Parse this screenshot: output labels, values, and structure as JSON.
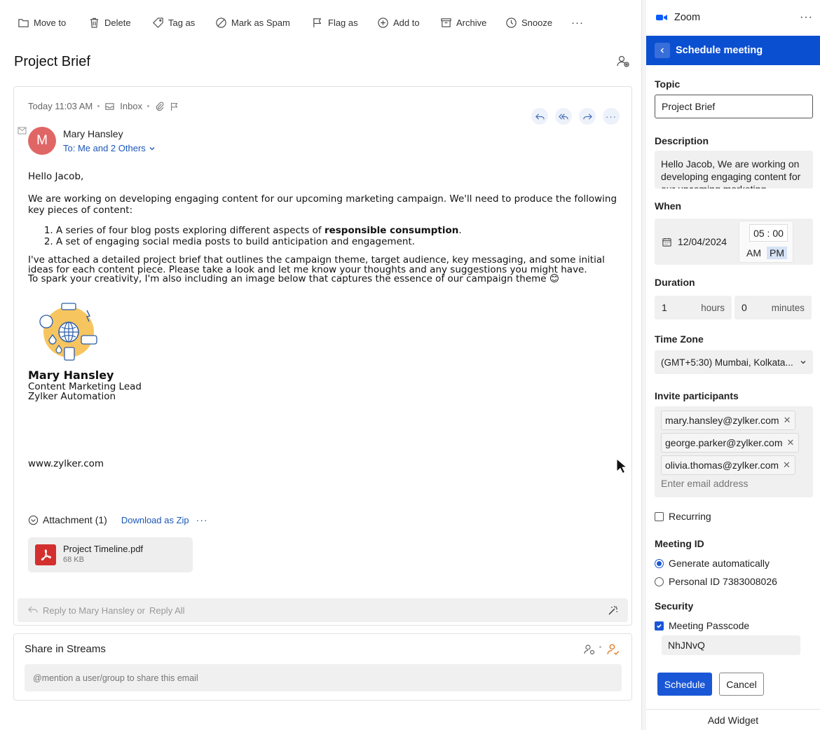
{
  "toolbar": {
    "items": [
      {
        "label": "Move to",
        "icon": "folder-icon"
      },
      {
        "label": "Delete",
        "icon": "trash-icon"
      },
      {
        "label": "Tag as",
        "icon": "tag-icon"
      },
      {
        "label": "Mark as Spam",
        "icon": "spam-icon"
      },
      {
        "label": "Flag as",
        "icon": "flag-icon"
      },
      {
        "label": "Add to",
        "icon": "plus-circle-icon"
      },
      {
        "label": "Archive",
        "icon": "archive-icon"
      },
      {
        "label": "Snooze",
        "icon": "clock-icon"
      }
    ],
    "more": "···"
  },
  "email": {
    "subject": "Project Brief",
    "time": "Today 11:03 AM",
    "folder": "Inbox",
    "sender_initial": "M",
    "sender_name": "Mary Hansley",
    "to_line": "To: Me and 2 Others",
    "greeting": "Hello Jacob,",
    "para1": "We are working on developing engaging content for our upcoming marketing campaign. We'll need to produce the following key pieces of content:",
    "list1_pre": "A series of four blog posts exploring different aspects of ",
    "list1_bold": "responsible consumption",
    "list1_post": ".",
    "list2": "A set of engaging social media posts to build anticipation and engagement.",
    "para2_line1": "I've attached a detailed project brief that outlines the campaign theme, target audience, key messaging, and some initial ideas for each content piece. Please take a look and let me know your thoughts and any suggestions you might have.",
    "para2_line2": "To spark your creativity, I'm also including an image below that captures the essence of our campaign theme 😊",
    "sig_name": "Mary Hansley",
    "sig_role": "Content Marketing Lead",
    "sig_company": "Zylker Automation",
    "sig_web": "www.zylker.com"
  },
  "attachments": {
    "header": "Attachment (1)",
    "download": "Download as Zip",
    "more": "···",
    "file_name": "Project Timeline.pdf",
    "file_size": "68 KB"
  },
  "reply": {
    "reply_text": "Reply to Mary Hansley or",
    "reply_all": "Reply All"
  },
  "streams": {
    "title": "Share in Streams",
    "placeholder": "@mention a user/group to share this email"
  },
  "zoom": {
    "app_name": "Zoom",
    "more": "···",
    "panel_title": "Schedule meeting",
    "topic_label": "Topic",
    "topic_value": "Project Brief",
    "description_label": "Description",
    "description_value": "Hello Jacob, We are working on developing engaging content for our upcoming marketing",
    "when_label": "When",
    "date_value": "12/04/2024",
    "time_value": "05 : 00",
    "am": "AM",
    "pm": "PM",
    "duration_label": "Duration",
    "hours_value": "1",
    "hours_unit": "hours",
    "minutes_value": "0",
    "minutes_unit": "minutes",
    "timezone_label": "Time Zone",
    "timezone_value": "(GMT+5:30) Mumbai, Kolkata...",
    "invite_label": "Invite participants",
    "participants": [
      "mary.hansley@zylker.com",
      "george.parker@zylker.com",
      "olivia.thomas@zylker.com"
    ],
    "invite_placeholder": "Enter email address",
    "recurring_label": "Recurring",
    "meeting_id_label": "Meeting ID",
    "generate_auto": "Generate automatically",
    "personal_id": "Personal ID 7383008026",
    "security_label": "Security",
    "passcode_label": "Meeting Passcode",
    "passcode_value": "NhJNvQ",
    "schedule_button": "Schedule",
    "cancel_button": "Cancel",
    "add_widget": "Add Widget"
  },
  "colors": {
    "accent": "#0b4fd1",
    "button": "#1a57d6",
    "link": "#1a57b8",
    "avatar": "#e06666",
    "pdf": "#d32f2f"
  }
}
